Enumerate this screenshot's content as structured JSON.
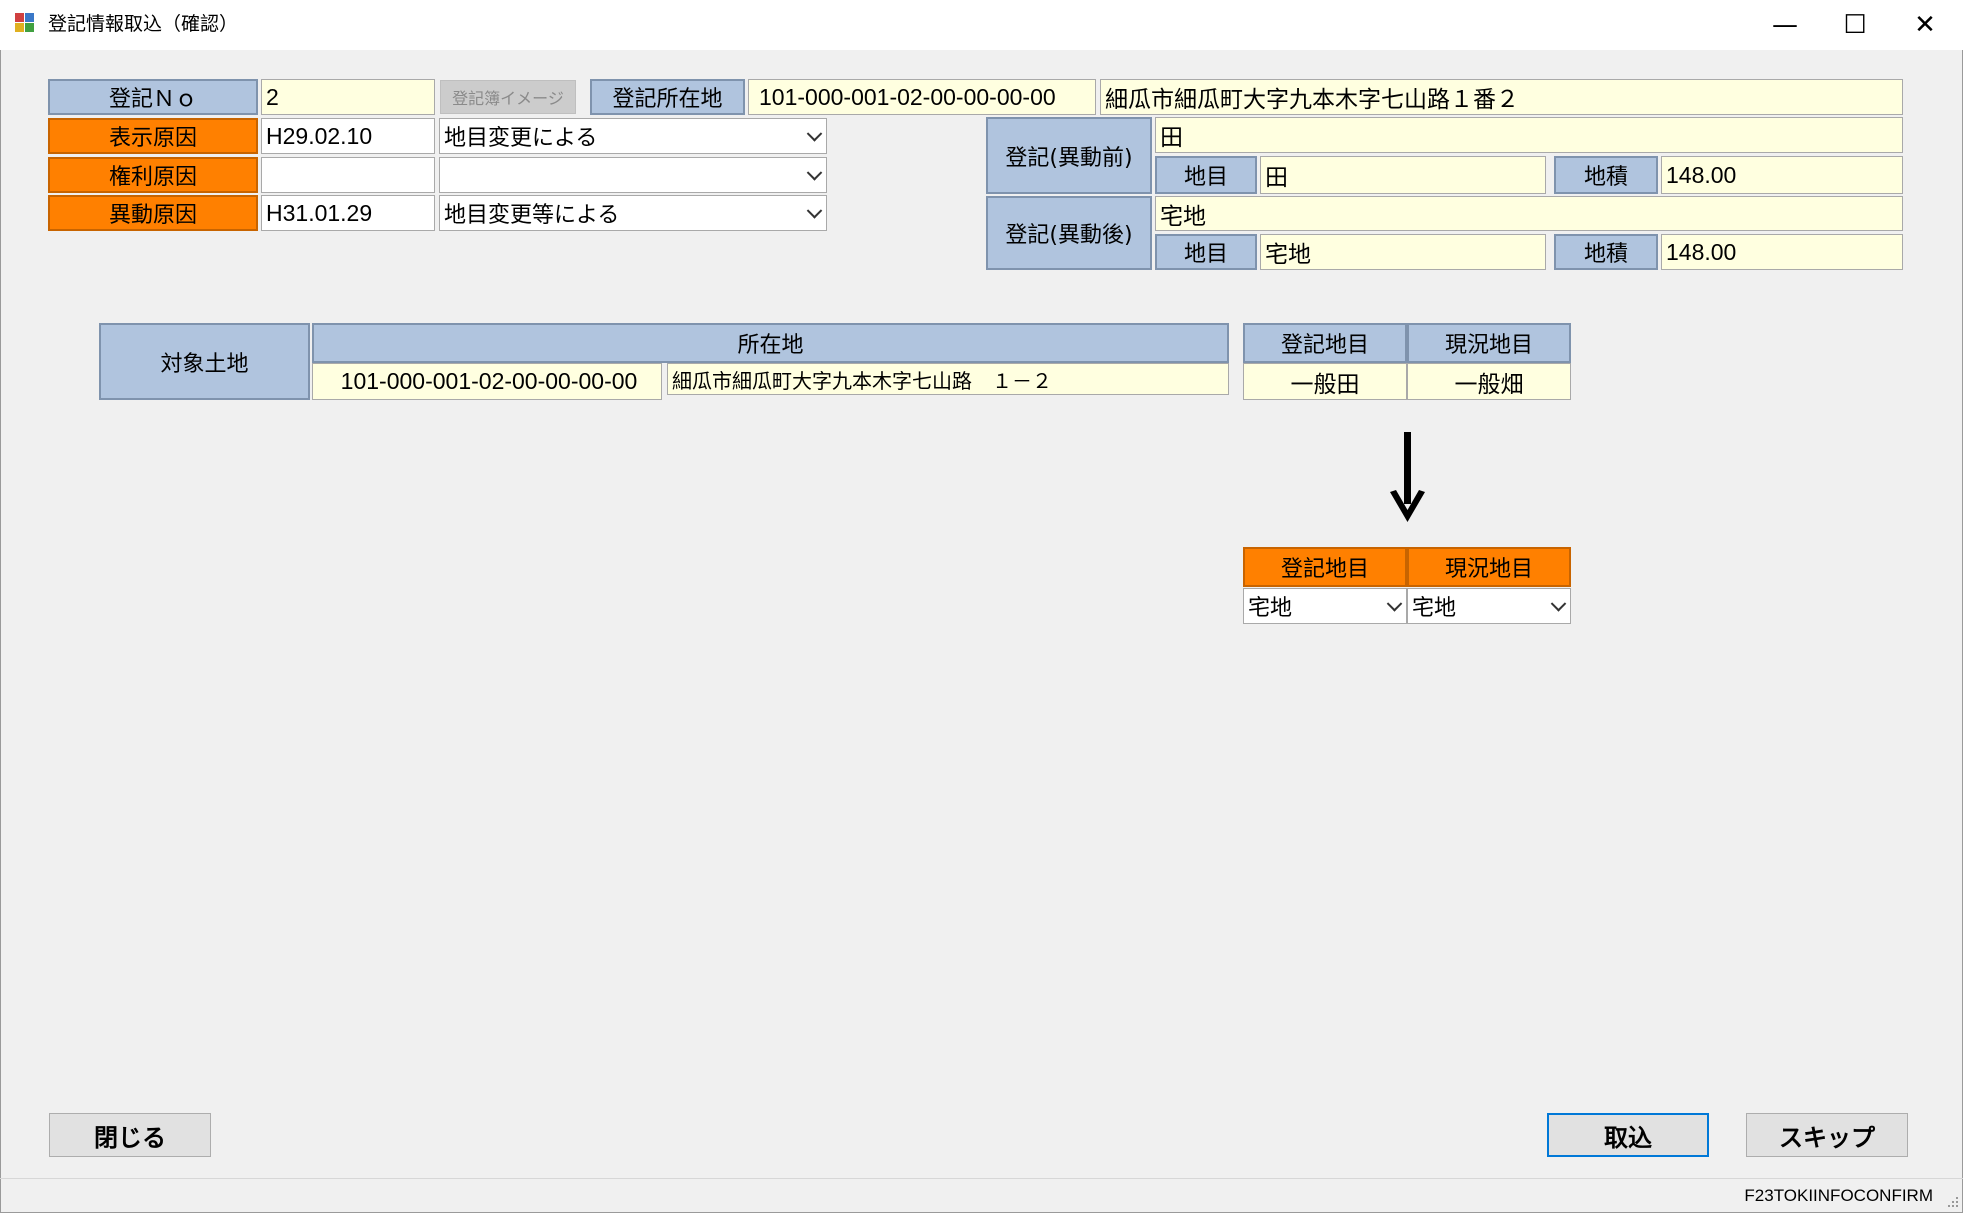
{
  "window": {
    "title": "登記情報取込（確認）",
    "minimize_symbol": "—",
    "maximize_symbol": "☐",
    "close_symbol": "✕"
  },
  "header": {
    "no_label": "登記Ｎｏ",
    "no_value": "2",
    "image_button": "登記簿イメージ",
    "location_label": "登記所在地",
    "location_code": "101-000-001-02-00-00-00-00",
    "location_address": "細瓜市細瓜町大字九本木字七山路１番２",
    "display_cause_label": "表示原因",
    "display_cause_date": "H29.02.10",
    "display_cause_value": "地目変更による",
    "right_cause_label": "権利原因",
    "right_cause_date": "",
    "right_cause_value": "",
    "change_cause_label": "異動原因",
    "change_cause_date": "H31.01.29",
    "change_cause_value": "地目変更等による"
  },
  "before": {
    "label": "登記(異動前)",
    "value": "田",
    "chimoku_label": "地目",
    "chimoku_value": "田",
    "area_label": "地積",
    "area_value": "148.00"
  },
  "after": {
    "label": "登記(異動後)",
    "value": "宅地",
    "chimoku_label": "地目",
    "chimoku_value": "宅地",
    "area_label": "地積",
    "area_value": "148.00"
  },
  "target": {
    "label": "対象土地",
    "location_header": "所在地",
    "location_code": "101-000-001-02-00-00-00-00",
    "location_address": "細瓜市細瓜町大字九本木字七山路　１－２",
    "reg_chimoku_header": "登記地目",
    "cur_chimoku_header": "現況地目",
    "reg_chimoku_value": "一般田",
    "cur_chimoku_value": "一般畑"
  },
  "result": {
    "arrow": "↓",
    "reg_chimoku_header": "登記地目",
    "cur_chimoku_header": "現況地目",
    "reg_chimoku_value": "宅地",
    "cur_chimoku_value": "宅地"
  },
  "buttons": {
    "close": "閉じる",
    "import": "取込",
    "skip": "スキップ"
  },
  "status": {
    "form_id": "F23TOKIINFOCONFIRM"
  },
  "colors": {
    "label_blue": "#b0c4de",
    "label_orange": "#ff8000",
    "field_yellow": "#ffffe0",
    "background": "#f0f0f0"
  }
}
